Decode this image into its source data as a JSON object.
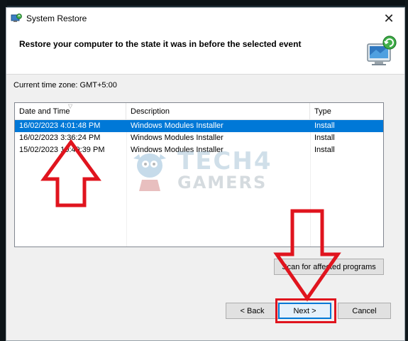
{
  "window": {
    "title": "System Restore",
    "close_glyph": "✕"
  },
  "header": {
    "title": "Restore your computer to the state it was in before the selected event",
    "icon": "system-restore-icon"
  },
  "timezone": {
    "label": "Current time zone: GMT+5:00"
  },
  "restore_points": {
    "columns": [
      "Date and Time",
      "Description",
      "Type"
    ],
    "sort_indicator": "▽",
    "rows": [
      {
        "date_time": "16/02/2023 4:01:48 PM",
        "description": "Windows Modules Installer",
        "type": "Install",
        "selected": true
      },
      {
        "date_time": "16/02/2023 3:36:24 PM",
        "description": "Windows Modules Installer",
        "type": "Install",
        "selected": false
      },
      {
        "date_time": "15/02/2023 10:49:39 PM",
        "description": "Windows Modules Installer",
        "type": "Install",
        "selected": false
      }
    ]
  },
  "buttons": {
    "scan": "Scan for affected programs",
    "back": "< Back",
    "next": "Next >",
    "cancel": "Cancel"
  },
  "watermark": {
    "line1": "TECH4",
    "line2": "GAMERS"
  },
  "colors": {
    "selection": "#0078d7",
    "annotation_red": "#e0141e",
    "window_bg": "#f0f0f0"
  }
}
